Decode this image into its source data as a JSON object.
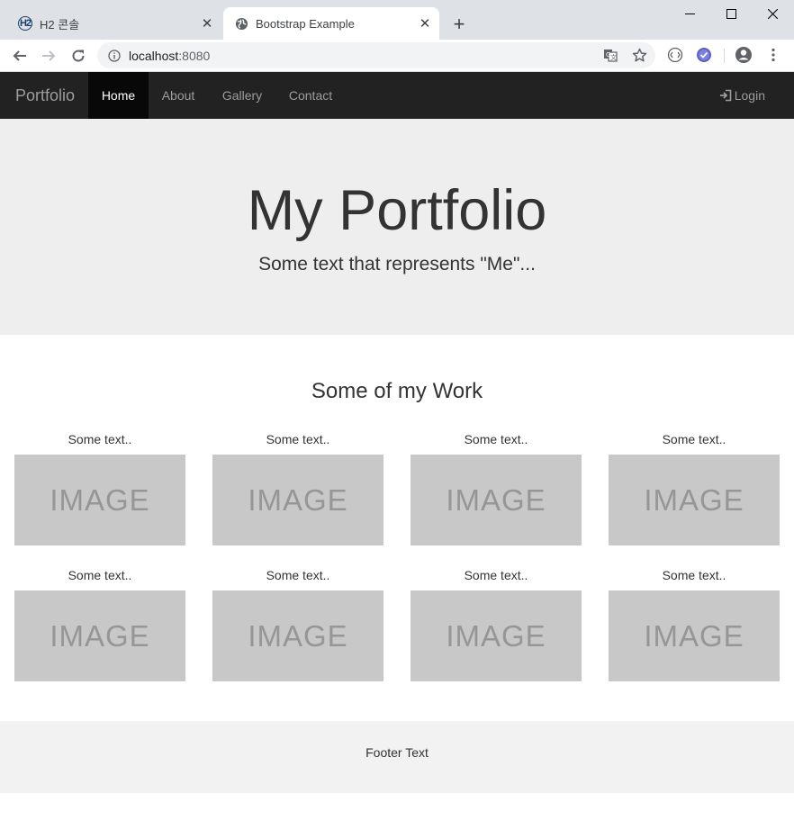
{
  "browser": {
    "tabs": [
      {
        "title": "H2 콘솔",
        "icon": "h2-logo-icon",
        "active": false
      },
      {
        "title": "Bootstrap Example",
        "icon": "globe-icon",
        "active": true
      }
    ],
    "url_host": "localhost",
    "url_port": ":8080"
  },
  "navbar": {
    "brand": "Portfolio",
    "items": [
      "Home",
      "About",
      "Gallery",
      "Contact"
    ],
    "active_index": 0,
    "login_label": "Login"
  },
  "hero": {
    "title": "My Portfolio",
    "subtitle": "Some text that represents \"Me\"..."
  },
  "work": {
    "heading": "Some of my Work",
    "cards": [
      {
        "caption": "Some text..",
        "image_label": "IMAGE"
      },
      {
        "caption": "Some text..",
        "image_label": "IMAGE"
      },
      {
        "caption": "Some text..",
        "image_label": "IMAGE"
      },
      {
        "caption": "Some text..",
        "image_label": "IMAGE"
      },
      {
        "caption": "Some text..",
        "image_label": "IMAGE"
      },
      {
        "caption": "Some text..",
        "image_label": "IMAGE"
      },
      {
        "caption": "Some text..",
        "image_label": "IMAGE"
      },
      {
        "caption": "Some text..",
        "image_label": "IMAGE"
      }
    ]
  },
  "footer": {
    "text": "Footer Text"
  },
  "colors": {
    "navbar_bg": "#222222",
    "hero_bg": "#eeeeee",
    "placeholder_bg": "#c8c8c8",
    "footer_bg": "#f2f2f2"
  }
}
